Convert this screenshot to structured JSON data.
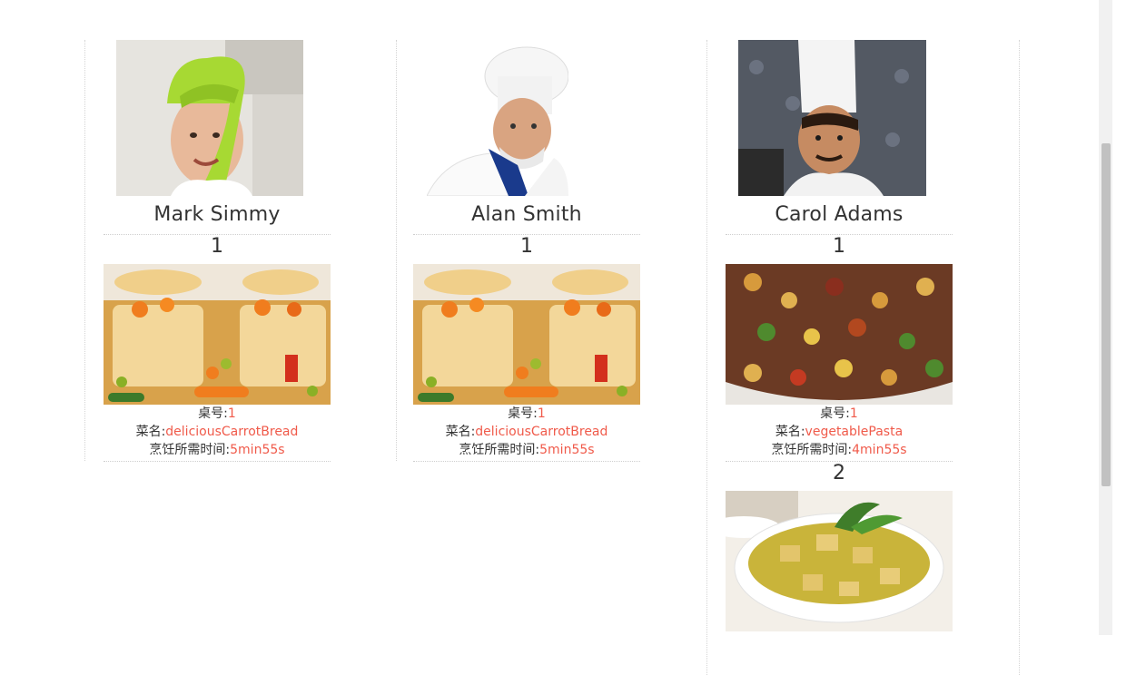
{
  "labels": {
    "table": "桌号:",
    "dish": "菜名:",
    "cook_time": "烹饪所需时间:"
  },
  "chefs": [
    {
      "name": "Mark Simmy",
      "orders": [
        {
          "num": "1",
          "table": "1",
          "dish": "deliciousCarrotBread",
          "time": "5min55s",
          "image": "vol-au-vent"
        }
      ]
    },
    {
      "name": "Alan Smith",
      "orders": [
        {
          "num": "1",
          "table": "1",
          "dish": "deliciousCarrotBread",
          "time": "5min55s",
          "image": "vol-au-vent"
        }
      ]
    },
    {
      "name": "Carol Adams",
      "orders": [
        {
          "num": "1",
          "table": "1",
          "dish": "vegetablePasta",
          "time": "4min55s",
          "image": "pasta"
        },
        {
          "num": "2",
          "image": "soup"
        }
      ]
    }
  ],
  "colors": {
    "value": "#f05a4a",
    "text": "#333333",
    "divider": "#d4d4d4"
  }
}
